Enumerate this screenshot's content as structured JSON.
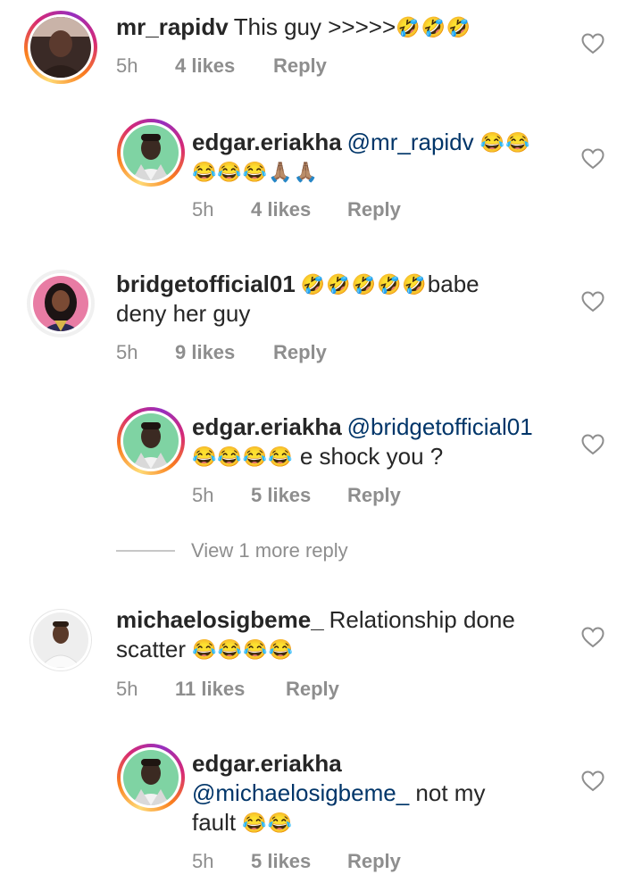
{
  "comments": [
    {
      "username": "mr_rapidv",
      "text": "This guy >>>>>",
      "emoji": "🤣🤣🤣",
      "time": "5h",
      "likes": "4 likes",
      "reply": "Reply",
      "level": "top"
    },
    {
      "username": "edgar.eriakha",
      "mention": "@mr_rapidv",
      "emoji_line1": "😂😂",
      "emoji_line2": "😂😂😂🙏🏽🙏🏽",
      "time": "5h",
      "likes": "4 likes",
      "reply": "Reply",
      "level": "reply"
    },
    {
      "username": "bridgetofficial01",
      "emoji": "🤣🤣🤣🤣🤣",
      "text_after": "babe",
      "text_line2": "deny her guy",
      "time": "5h",
      "likes": "9 likes",
      "reply": "Reply",
      "level": "top"
    },
    {
      "username": "edgar.eriakha",
      "mention": "@bridgetofficial01",
      "emoji_line2": "😂😂😂😂",
      "text_line2": "e shock you ?",
      "time": "5h",
      "likes": "5 likes",
      "reply": "Reply",
      "level": "reply"
    },
    {
      "username": "michaelosigbeme_",
      "text": "Relationship done",
      "text_line2": "scatter",
      "emoji_line2": "😂😂😂😂",
      "time": "5h",
      "likes": "11 likes",
      "reply": "Reply",
      "level": "top"
    },
    {
      "username": "edgar.eriakha",
      "mention": "@michaelosigbeme_",
      "text_after_mention": "not my",
      "text_line3": "fault",
      "emoji_line3": "😂😂",
      "time": "5h",
      "likes": "5 likes",
      "reply": "Reply",
      "level": "reply"
    }
  ],
  "view_more_replies": "View 1 more reply",
  "colors": {
    "text": "#262626",
    "meta": "#8e8e8e",
    "mention": "#003569",
    "story_ring": [
      "#feda75",
      "#fa7e1e",
      "#d62976",
      "#962fbf"
    ]
  },
  "icons": [
    "heart-outline-icon"
  ]
}
